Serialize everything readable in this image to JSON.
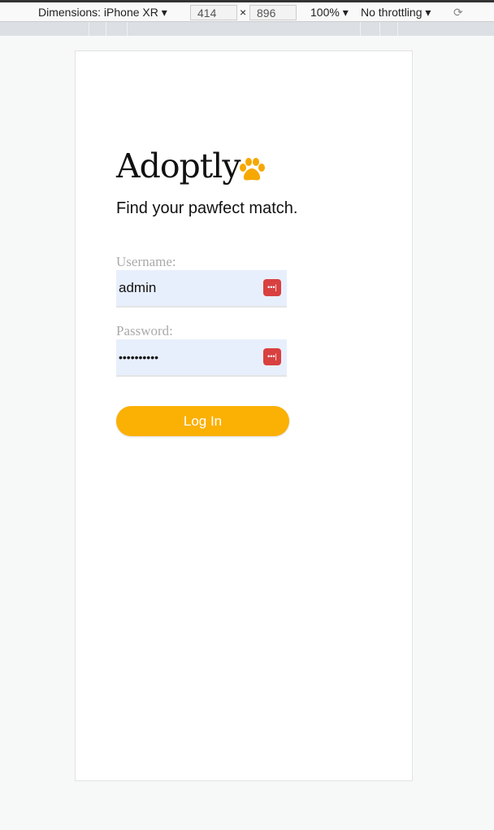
{
  "devtools": {
    "dimensions_label": "Dimensions: iPhone XR",
    "width": "414",
    "times": "×",
    "height": "896",
    "zoom": "100%",
    "throttling": "No throttling"
  },
  "app": {
    "title": "Adoptly",
    "tagline": "Find your pawfect match.",
    "username_label": "Username:",
    "username_value": "admin",
    "password_label": "Password:",
    "password_value": "••••••••••",
    "login_label": "Log In"
  },
  "colors": {
    "accent": "#fbb004",
    "input_bg": "#e8effc",
    "key_icon": "#d94040"
  }
}
